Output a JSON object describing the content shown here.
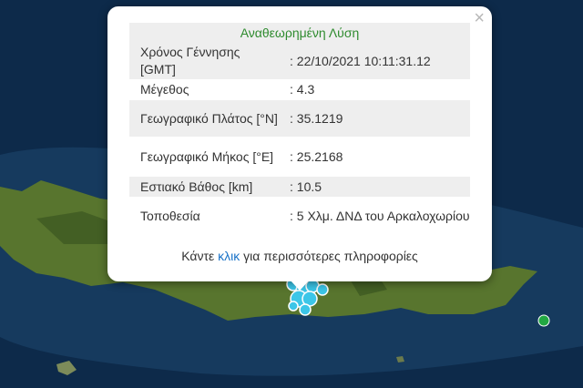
{
  "popup": {
    "close_glyph": "×",
    "title": "Αναθεωρημένη Λύση",
    "rows": [
      {
        "label": "Χρόνος Γέννησης [GMT]",
        "value": ": 22/10/2021 10:11:31.12"
      },
      {
        "label": "Μέγεθος",
        "value": ": 4.3"
      },
      {
        "label": "Γεωγραφικό Πλάτος [°N]",
        "value": ": 35.1219"
      },
      {
        "label": "Γεωγραφικό Μήκος [°E]",
        "value": ": 25.2168"
      },
      {
        "label": "Εστιακό Βάθος [km]",
        "value": ": 10.5"
      },
      {
        "label": "Τοποθεσία",
        "value": ": 5 Χλμ. ΔΝΔ του Αρκαλοχωρίου"
      }
    ],
    "footer_before": "Κάντε ",
    "footer_link": "κλικ",
    "footer_after": " για περισσότερες πληροφορίες"
  },
  "colors": {
    "sea": "#0d2a4a",
    "land": "#58752e",
    "quake_marker": "#3cc6e8",
    "marker_green": "#22a842",
    "title_text": "#2e8b2e",
    "link": "#1a73c8"
  }
}
